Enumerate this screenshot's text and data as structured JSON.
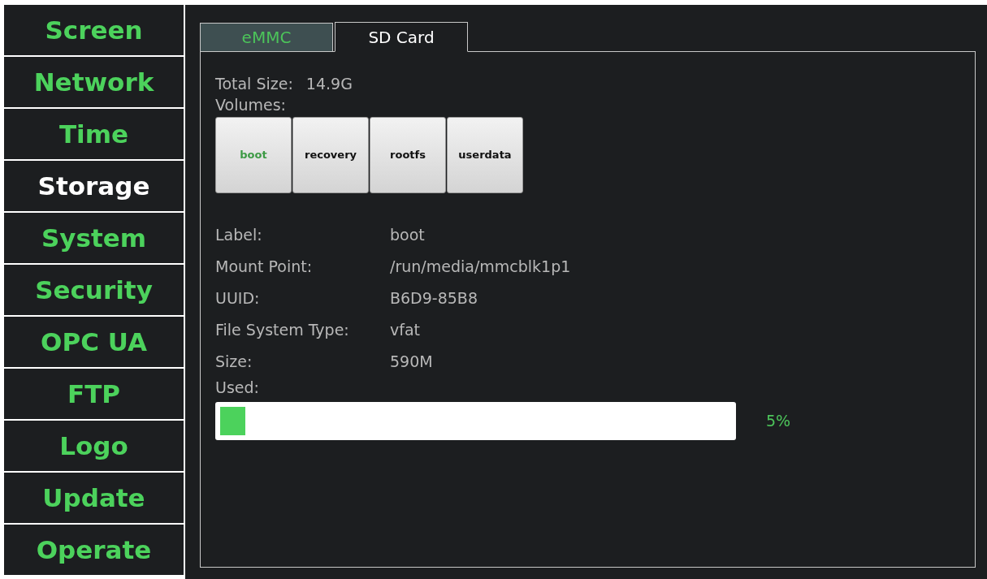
{
  "sidebar": {
    "items": [
      {
        "label": "Screen",
        "selected": false
      },
      {
        "label": "Network",
        "selected": false
      },
      {
        "label": "Time",
        "selected": false
      },
      {
        "label": "Storage",
        "selected": true
      },
      {
        "label": "System",
        "selected": false
      },
      {
        "label": "Security",
        "selected": false
      },
      {
        "label": "OPC UA",
        "selected": false
      },
      {
        "label": "FTP",
        "selected": false
      },
      {
        "label": "Logo",
        "selected": false
      },
      {
        "label": "Update",
        "selected": false
      },
      {
        "label": "Operate",
        "selected": false
      }
    ]
  },
  "tabs": [
    {
      "label": "eMMC",
      "selected": false
    },
    {
      "label": "SD Card",
      "selected": true
    }
  ],
  "total_size": {
    "label": "Total Size:",
    "value": "14.9G"
  },
  "volumes": {
    "label": "Volumes:",
    "items": [
      {
        "label": "boot",
        "selected": true
      },
      {
        "label": "recovery",
        "selected": false
      },
      {
        "label": "rootfs",
        "selected": false
      },
      {
        "label": "userdata",
        "selected": false
      }
    ]
  },
  "details": [
    {
      "label": "Label:",
      "value": "boot"
    },
    {
      "label": "Mount Point:",
      "value": "/run/media/mmcblk1p1"
    },
    {
      "label": "UUID:",
      "value": "B6D9-85B8"
    },
    {
      "label": "File System Type:",
      "value": "vfat"
    },
    {
      "label": "Size:",
      "value": "590M"
    }
  ],
  "used": {
    "label": "Used:",
    "level": 0.05,
    "reading": "5%"
  }
}
